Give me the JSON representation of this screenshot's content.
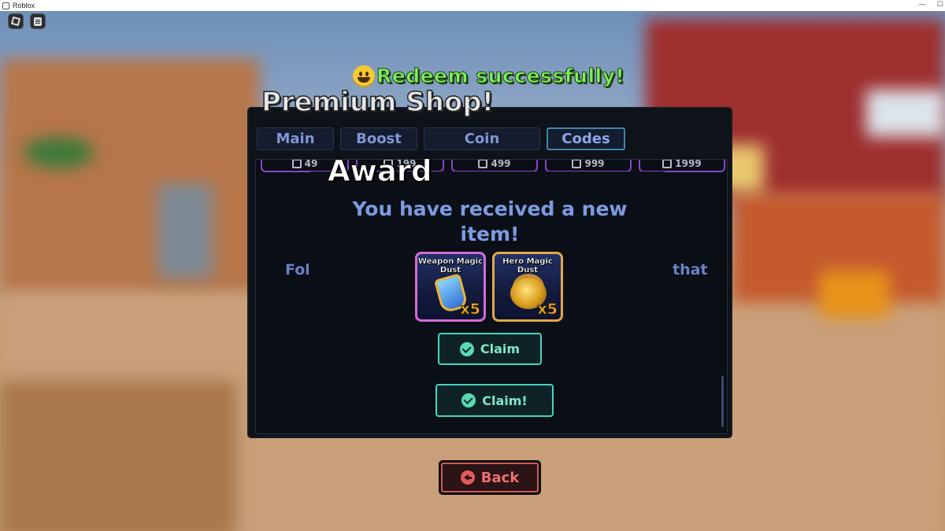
{
  "window": {
    "title": "Roblox",
    "controls": [
      "—",
      "☐"
    ]
  },
  "notification": {
    "icon": "smiley-icon",
    "text": "Redeem successfully!"
  },
  "shop": {
    "title": "Premium Shop!",
    "tabs": [
      {
        "label": "Main"
      },
      {
        "label": "Boost"
      },
      {
        "label": "Coin"
      },
      {
        "label": "Codes",
        "active": true
      }
    ],
    "prices": [
      "49",
      "199",
      "499",
      "999",
      "1999"
    ],
    "follow_left": "Foll",
    "follow_right": "that",
    "claim_button": "Claim!"
  },
  "award": {
    "title": "Award",
    "message": "You have received a new item!",
    "items": [
      {
        "name": "Weapon Magic Dust",
        "quantity": "x5",
        "icon": "weapon-magic-dust-icon"
      },
      {
        "name": "Hero Magic Dust",
        "quantity": "x5",
        "icon": "hero-magic-dust-icon"
      }
    ],
    "claim_button": "Claim"
  },
  "back_button": "Back",
  "colors": {
    "panel_bg": "#0e1219",
    "tab_text": "#7f96d6",
    "claim_border": "#43d6bd",
    "back_border": "#d35a5a",
    "notification_green": "#7cf25a",
    "price_border": "#8a44c9"
  }
}
